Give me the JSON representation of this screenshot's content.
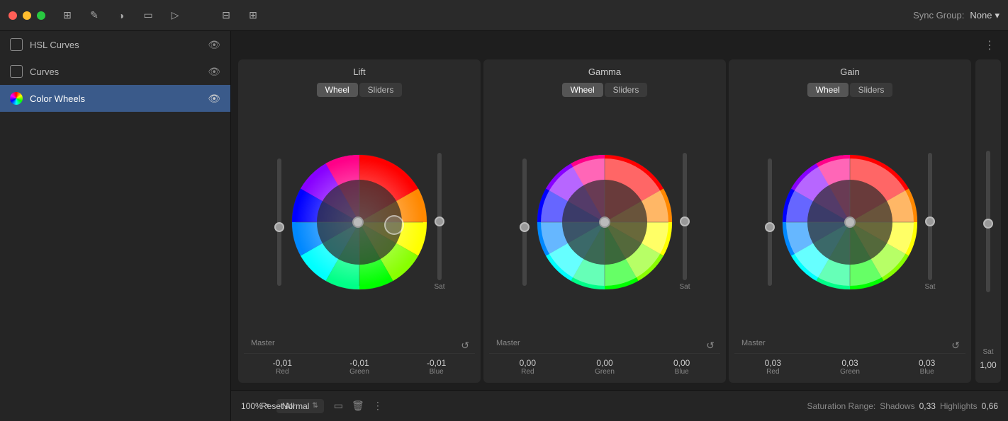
{
  "titlebar": {
    "sync_group_label": "Sync Group:",
    "sync_group_value": "None"
  },
  "sidebar": {
    "items": [
      {
        "id": "hsl-curves",
        "label": "HSL Curves",
        "icon_type": "square",
        "active": false
      },
      {
        "id": "curves",
        "label": "Curves",
        "icon_type": "square",
        "active": false
      },
      {
        "id": "color-wheels",
        "label": "Color Wheels",
        "icon_type": "wheel",
        "active": true
      }
    ]
  },
  "wheels": {
    "lift": {
      "title": "Lift",
      "tabs": [
        "Wheel",
        "Sliders"
      ],
      "active_tab": "Wheel",
      "values": {
        "red": "-0,01",
        "green": "-0,01",
        "blue": "-0,01",
        "red_label": "Red",
        "green_label": "Green",
        "blue_label": "Blue"
      },
      "master_label": "Master"
    },
    "gamma": {
      "title": "Gamma",
      "tabs": [
        "Wheel",
        "Sliders"
      ],
      "active_tab": "Wheel",
      "values": {
        "red": "0,00",
        "green": "0,00",
        "blue": "0,00",
        "red_label": "Red",
        "green_label": "Green",
        "blue_label": "Blue"
      },
      "master_label": "Master"
    },
    "gain": {
      "title": "Gain",
      "tabs": [
        "Wheel",
        "Sliders"
      ],
      "active_tab": "Wheel",
      "values": {
        "red": "0,03",
        "green": "0,03",
        "blue": "0,03",
        "red_label": "Red",
        "green_label": "Green",
        "blue_label": "Blue"
      },
      "master_label": "Master"
    }
  },
  "outer_sat": {
    "label": "Sat",
    "value": "1,00"
  },
  "bottom_bar": {
    "zoom": "100%",
    "blend_mode": "Normal",
    "reset_all": "Reset All",
    "saturation_range_label": "Saturation Range:",
    "shadows_label": "Shadows",
    "shadows_value": "0,33",
    "highlights_label": "Highlights",
    "highlights_value": "0,66"
  },
  "colors": {
    "active_sidebar_bg": "#3a5a8a",
    "panel_bg": "#2a2a2a",
    "active_tab_bg": "#555"
  }
}
